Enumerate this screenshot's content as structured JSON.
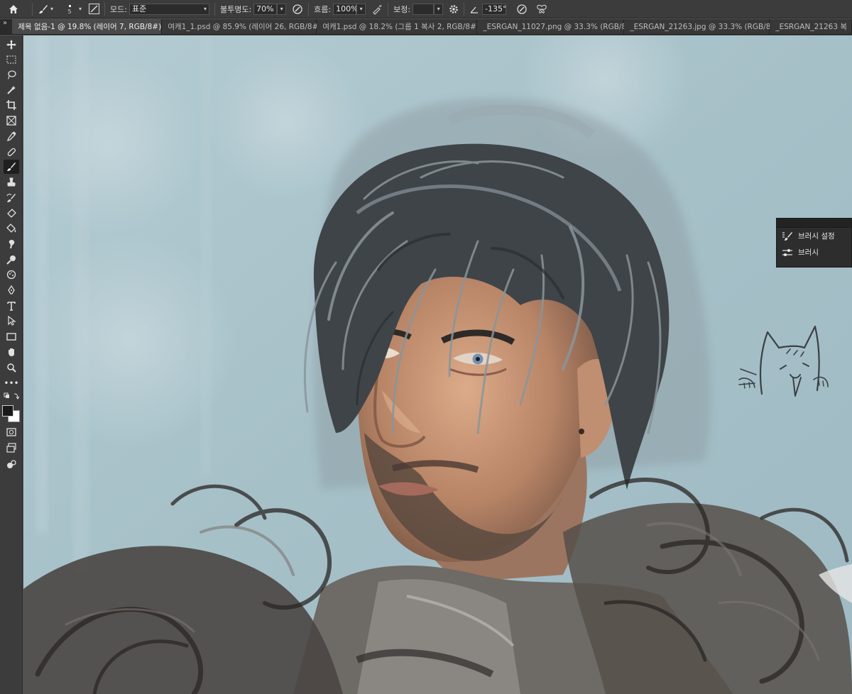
{
  "options_bar": {
    "brush_size": "5",
    "mode_label": "모드:",
    "mode_value": "표준",
    "opacity_label": "불투명도:",
    "opacity_value": "70%",
    "flow_label": "흐름:",
    "flow_value": "100%",
    "smoothing_label": "보정:",
    "smoothing_value": "",
    "angle_value": "-135°"
  },
  "tabs": [
    {
      "label": "제목 없음-1 @ 19.8% (레이어 7, RGB/8#) *",
      "active": true
    },
    {
      "label": "여캐1_1.psd @ 85.9% (레이어 26, RGB/8#)",
      "active": false
    },
    {
      "label": "여캐1.psd @ 18.2% (그룹 1 복사 2, RGB/8#) *",
      "active": false
    },
    {
      "label": "_ESRGAN_11027.png @ 33.3% (RGB/8#)",
      "active": false
    },
    {
      "label": "_ESRGAN_21263.jpg @ 33.3% (RGB/8#)",
      "active": false
    },
    {
      "label": "_ESRGAN_21263 복",
      "active": false
    }
  ],
  "tab_close_glyph": "×",
  "panel": {
    "items": [
      {
        "label": "브러시 설정",
        "icon": "brush-settings-icon"
      },
      {
        "label": "브러시",
        "icon": "brushes-icon"
      }
    ]
  },
  "toolbar": {
    "icons": [
      "move-icon",
      "marquee-icon",
      "lasso-icon",
      "magic-wand-icon",
      "crop-icon",
      "frame-icon",
      "eyedropper-icon",
      "healing-brush-icon",
      "brush-icon",
      "stamp-icon",
      "history-brush-icon",
      "eraser-icon",
      "paint-bucket-icon",
      "smudge-icon",
      "dodge-icon",
      "sponge-icon",
      "pen-icon",
      "type-icon",
      "path-select-icon",
      "rectangle-icon",
      "hand-icon",
      "zoom-icon",
      "more-tools-icon"
    ],
    "selected": "brush-icon",
    "foreground_color": "#1a1a1a",
    "background_color": "#ffffff"
  },
  "colors": {
    "sky": "#a9c4cc",
    "hair": "#3f4448",
    "skin": "#c9987a",
    "fur": "#4a4642"
  }
}
